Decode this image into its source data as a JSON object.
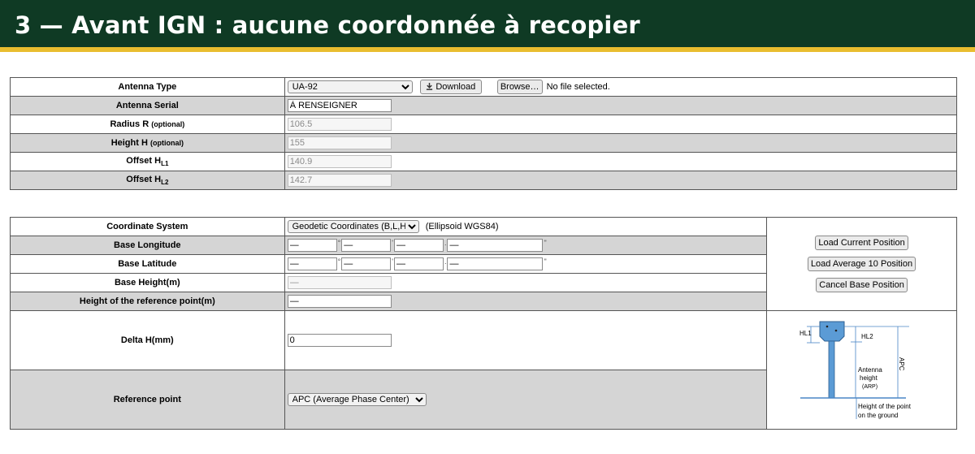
{
  "header": {
    "title": "3 — Avant IGN : aucune coordonnée à recopier"
  },
  "colors": {
    "header_bg": "#0f3a24",
    "stripe": "#e9bd2f",
    "row_alt": "#d5d5d5"
  },
  "antenna": {
    "type_label": "Antenna Type",
    "type_value": "UA-92",
    "download_label": "Download",
    "browse_label": "Browse…",
    "no_file_label": "No file selected.",
    "serial_label": "Antenna Serial",
    "serial_value": "À RENSEIGNER",
    "radius_label": "Radius R",
    "radius_optional": "(optional)",
    "radius_value": "106.5",
    "height_label": "Height H",
    "height_optional": "(optional)",
    "height_value": "155",
    "offset_prefix": "Offset H",
    "offset1_sub": "L1",
    "offset1_value": "140.9",
    "offset2_sub": "L2",
    "offset2_value": "142.7"
  },
  "base": {
    "cs_label": "Coordinate System",
    "cs_value": "Geodetic Coordinates (B,L,H)",
    "ellipsoid": "(Ellipsoid WGS84)",
    "lon_label": "Base Longitude",
    "lat_label": "Base Latitude",
    "dms_deg": "°",
    "dms_min": "'",
    "dms_dot": ".",
    "dms_sec": "\"",
    "placeholder": "—",
    "height_label": "Base Height(m)",
    "ref_height_label": "Height of the reference point(m)",
    "ref_height_value": "—",
    "delta_label": "Delta H(mm)",
    "delta_value": "0",
    "ref_point_label": "Reference point",
    "ref_point_value": "APC (Average Phase Center)",
    "load_current": "Load Current Position",
    "load_average": "Load Average 10 Position",
    "cancel_base": "Cancel Base Position"
  },
  "diagram": {
    "hl1": "HL1",
    "hl2": "HL2",
    "apc": "APC",
    "antenna": "Antenna",
    "height": "height",
    "arp": "(ARP)",
    "ground1": "Height of the point",
    "ground2": "on the ground"
  }
}
